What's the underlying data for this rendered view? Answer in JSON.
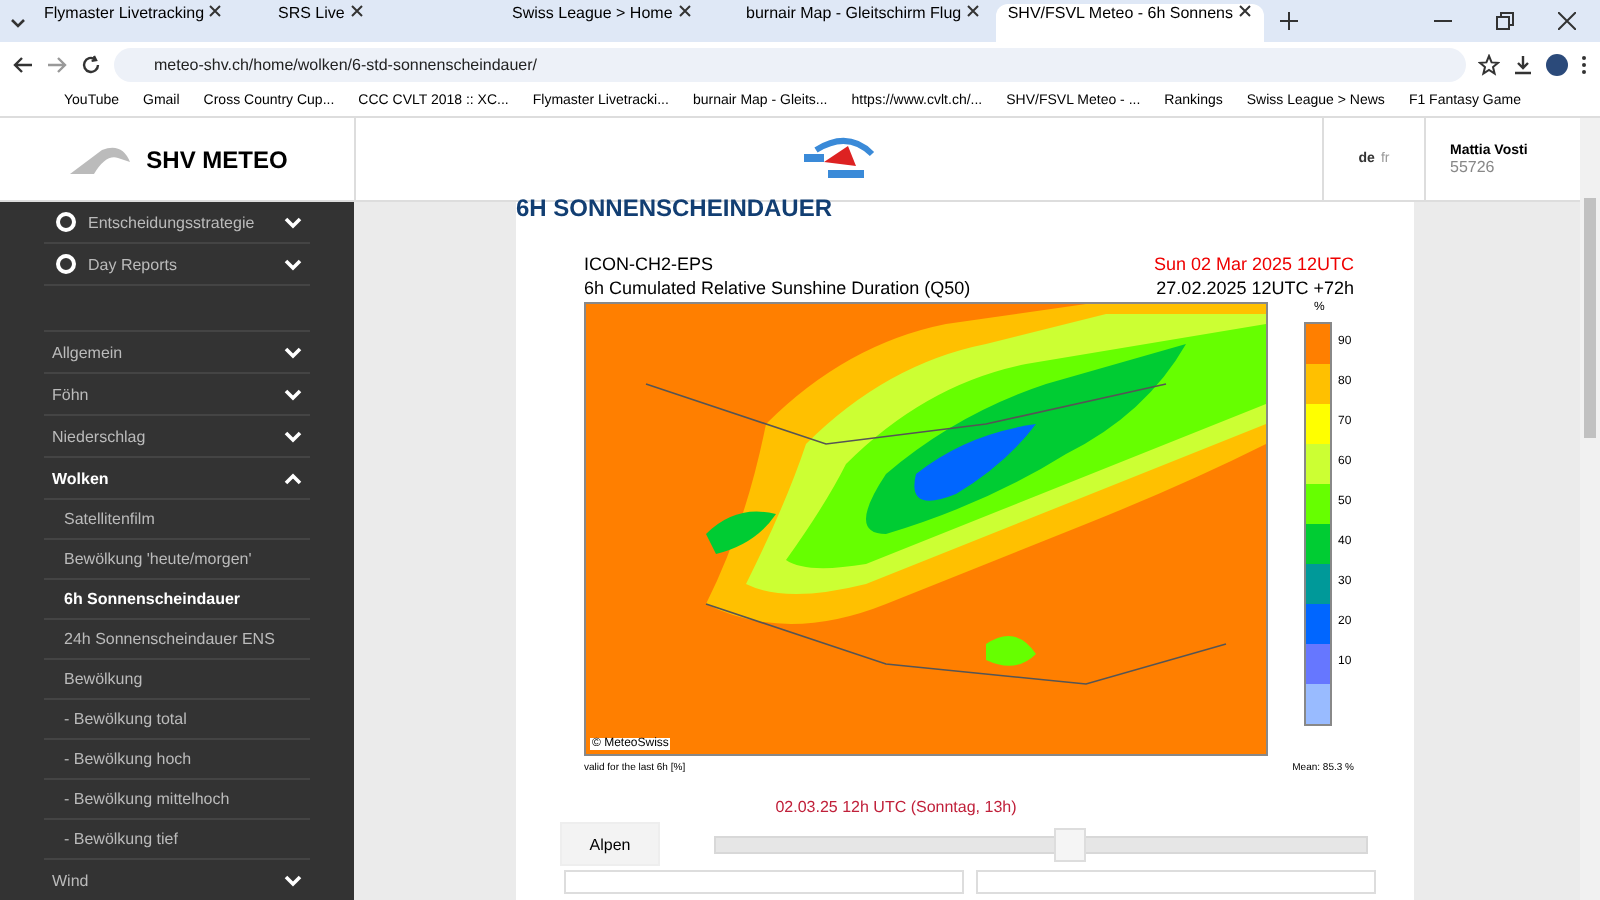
{
  "browser": {
    "tabs": [
      {
        "title": "Flymaster Livetracking",
        "selected": false
      },
      {
        "title": "SRS Live",
        "selected": false
      },
      {
        "title": "Swiss League > Home",
        "selected": false
      },
      {
        "title": "burnair Map - Gleitschirm Flug",
        "selected": false
      },
      {
        "title": "SHV/FSVL Meteo - 6h Sonnens",
        "selected": true
      }
    ],
    "url": "meteo-shv.ch/home/wolken/6-std-sonnenscheindauer/",
    "bookmarks": [
      "YouTube",
      "Gmail",
      "Cross Country Cup...",
      "CCC CVLT 2018 :: XC...",
      "Flymaster Livetracki...",
      "burnair Map - Gleits...",
      "https://www.cvlt.ch/...",
      "SHV/FSVL Meteo - ...",
      "Rankings",
      "Swiss League > News",
      "F1 Fantasy Game"
    ]
  },
  "header": {
    "brand": "SHV METEO",
    "languages": [
      {
        "code": "de",
        "selected": true
      },
      {
        "code": "fr",
        "selected": false
      }
    ],
    "user": {
      "name": "Mattia Vosti",
      "number": "55726"
    }
  },
  "sidebar": {
    "top_items": [
      "Entscheidungsstrategie",
      "Day Reports"
    ],
    "items": [
      {
        "label": "Allgemein",
        "expanded": false
      },
      {
        "label": "Föhn",
        "expanded": false
      },
      {
        "label": "Niederschlag",
        "expanded": false
      },
      {
        "label": "Wolken",
        "expanded": true,
        "children": [
          {
            "label": "Satellitenfilm",
            "selected": false
          },
          {
            "label": "Bewölkung 'heute/morgen'",
            "selected": false
          },
          {
            "label": "6h Sonnenscheindauer",
            "selected": true
          },
          {
            "label": "24h Sonnenscheindauer ENS",
            "selected": false
          },
          {
            "label": "Bewölkung",
            "selected": false
          },
          {
            "label": "- Bewölkung total",
            "selected": false
          },
          {
            "label": "- Bewölkung hoch",
            "selected": false
          },
          {
            "label": "- Bewölkung mittelhoch",
            "selected": false
          },
          {
            "label": "- Bewölkung tief",
            "selected": false
          }
        ]
      },
      {
        "label": "Wind",
        "expanded": false
      }
    ]
  },
  "page_title": "6H SONNENSCHEINDAUER",
  "map": {
    "model": "ICON-CH2-EPS",
    "subtitle": "6h Cumulated Relative Sunshine Duration (Q50)",
    "valid_time": "Sun 02 Mar 2025 12UTC",
    "run": "27.02.2025 12UTC +72h",
    "credit": "© MeteoSwiss",
    "footnote": "valid for the last 6h [%]",
    "mean": "Mean:  85.3 %",
    "legend_unit": "%",
    "legend": [
      {
        "label": "90",
        "color": "#ff7f00"
      },
      {
        "label": "80",
        "color": "#ffc000"
      },
      {
        "label": "70",
        "color": "#ffff00"
      },
      {
        "label": "60",
        "color": "#ccff33"
      },
      {
        "label": "50",
        "color": "#66ff00"
      },
      {
        "label": "40",
        "color": "#00cc33"
      },
      {
        "label": "30",
        "color": "#009999"
      },
      {
        "label": "20",
        "color": "#0066ff"
      },
      {
        "label": "10",
        "color": "#6677ff"
      },
      {
        "color": "#99bbff"
      }
    ]
  },
  "timeline": {
    "label": "02.03.25 12h UTC (Sonntag, 13h)",
    "level": 0.55
  },
  "region_button": "Alpen"
}
